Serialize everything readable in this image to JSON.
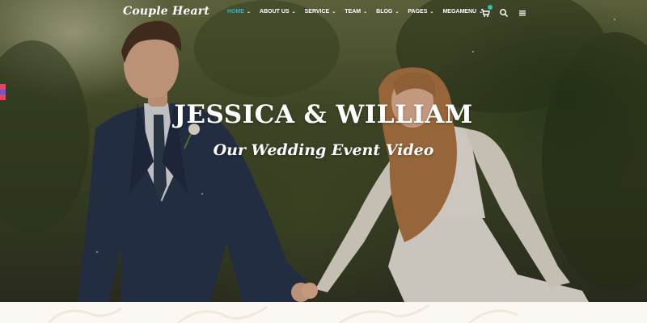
{
  "brand": {
    "logo_text": "Couple Heart"
  },
  "nav": {
    "items": [
      {
        "label": "HOME",
        "has_caret": true,
        "active": true
      },
      {
        "label": "ABOUT US",
        "has_caret": true,
        "active": false
      },
      {
        "label": "SERVICE",
        "has_caret": true,
        "active": false
      },
      {
        "label": "TEAM",
        "has_caret": true,
        "active": false
      },
      {
        "label": "BLOG",
        "has_caret": true,
        "active": false
      },
      {
        "label": "PAGES",
        "has_caret": true,
        "active": false
      },
      {
        "label": "MEGAMENU",
        "has_caret": true,
        "active": false
      }
    ],
    "caret_glyph": "⌄"
  },
  "tools": {
    "cart_icon": "cart-icon",
    "search_icon": "search-icon",
    "menu_icon": "hamburger-menu-icon"
  },
  "hero": {
    "title": "JESSICA & WILLIAM",
    "subtitle": "Our Wedding Event Video"
  },
  "colors": {
    "accent": "#3ab0c6",
    "badge": "#2ec4a6",
    "suit": "#25324d",
    "dress": "#f1ebe3",
    "page_bg": "#fbf8f3"
  }
}
